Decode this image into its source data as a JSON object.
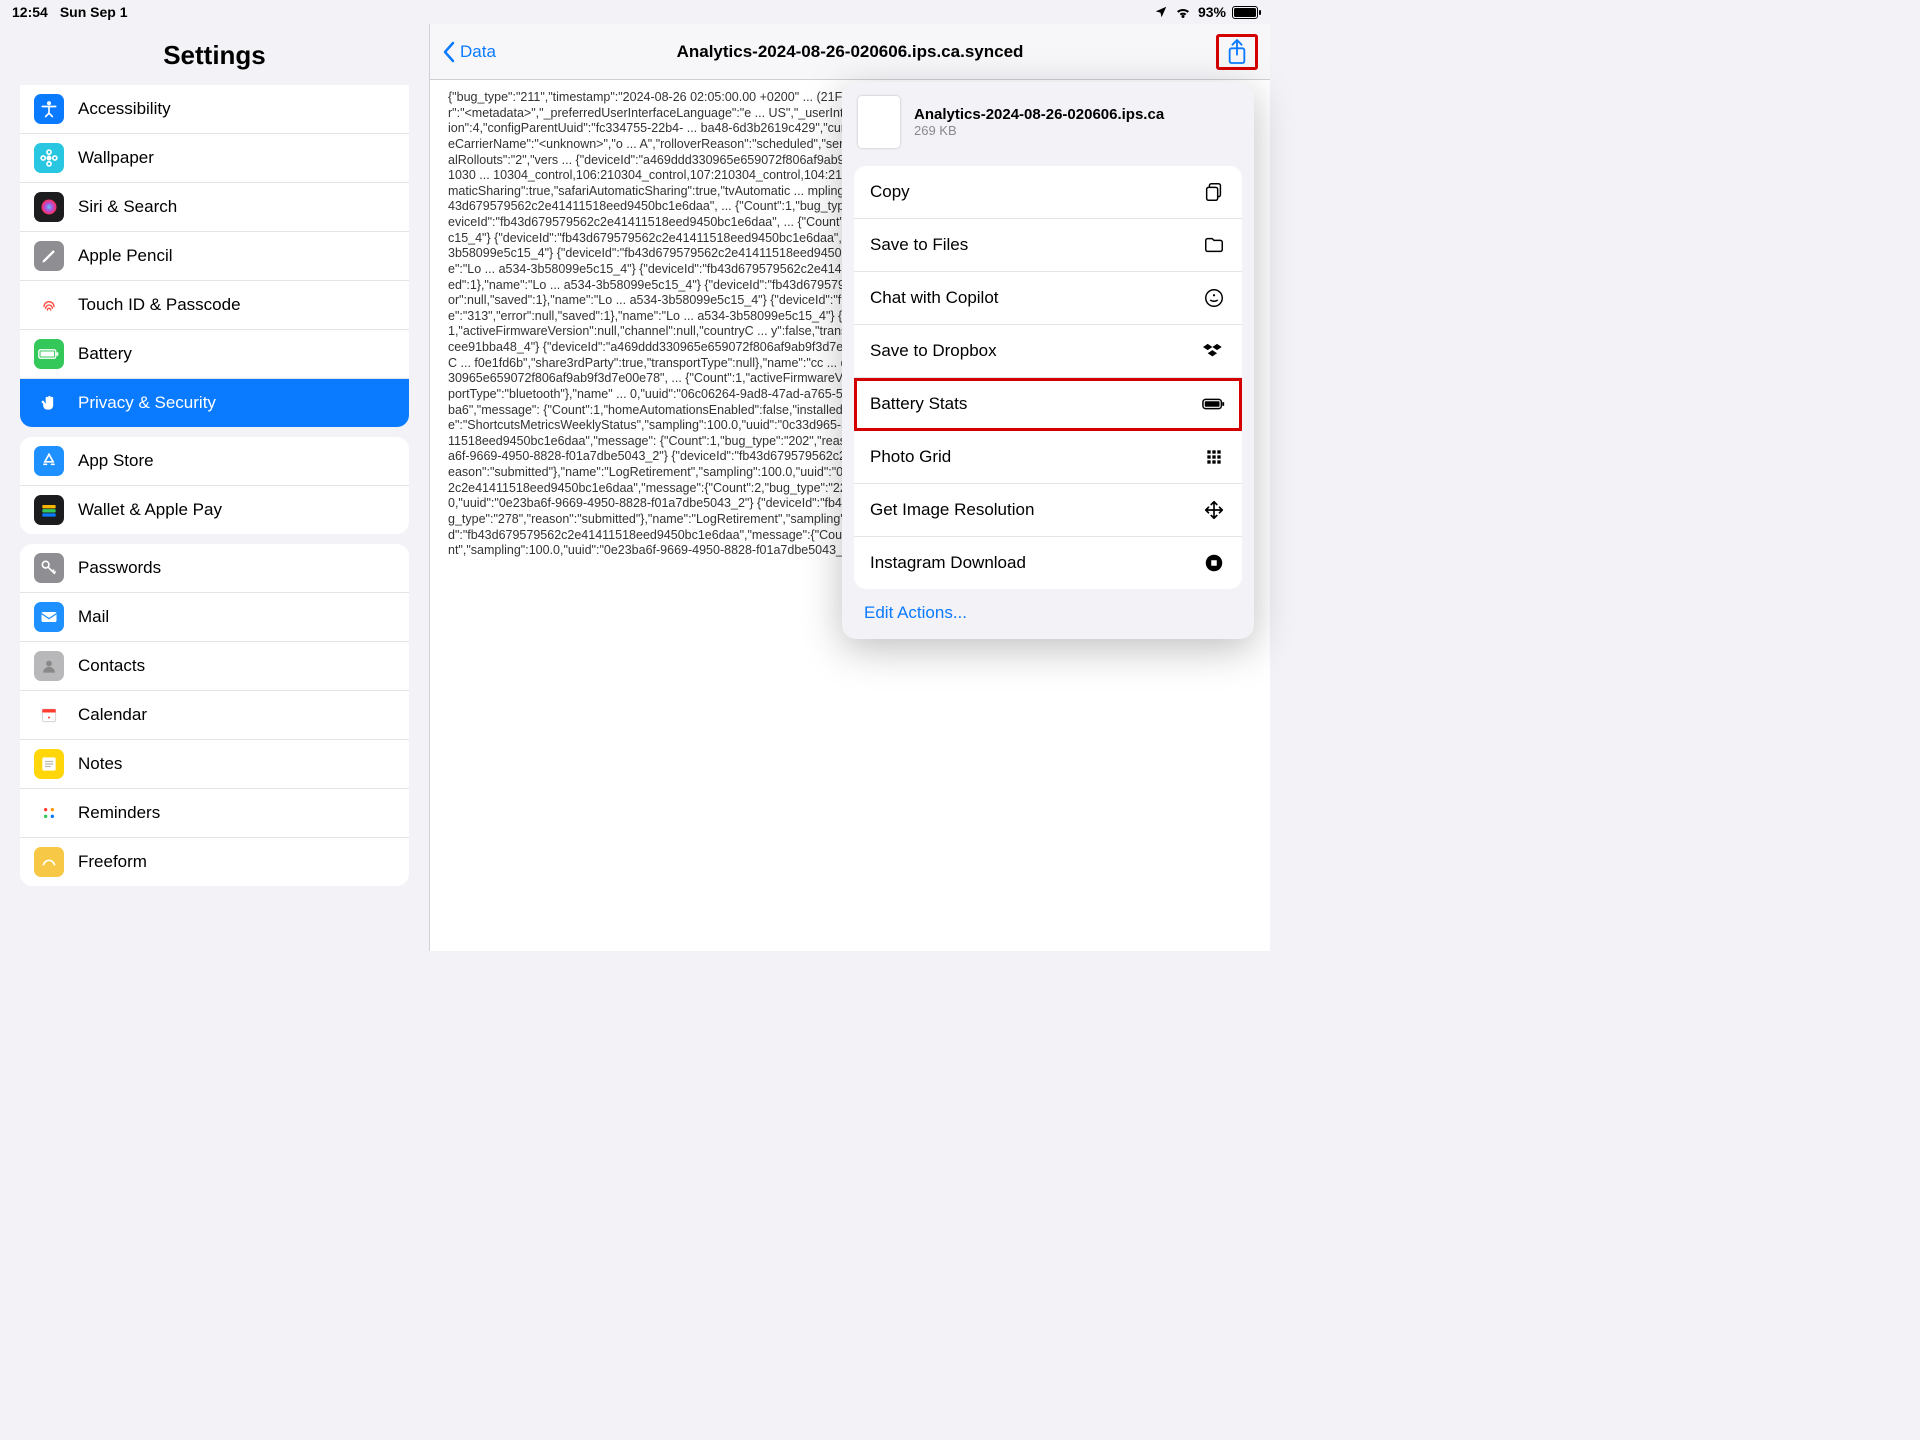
{
  "status": {
    "time": "12:54",
    "date": "Sun Sep 1",
    "location_icon": "location-icon",
    "wifi_icon": "wifi-icon",
    "battery_pct": "93%"
  },
  "sidebar": {
    "title": "Settings",
    "group1": [
      {
        "label": "Accessibility",
        "icon_bg": "#0a7aff",
        "data_name": "sidebar-item-accessibility",
        "icon": "accessibility-icon"
      },
      {
        "label": "Wallpaper",
        "icon_bg": "#28c6e0",
        "data_name": "sidebar-item-wallpaper",
        "icon": "flower-icon"
      },
      {
        "label": "Siri & Search",
        "icon_bg": "#1c1c1e",
        "data_name": "sidebar-item-siri",
        "icon": "siri-icon"
      },
      {
        "label": "Apple Pencil",
        "icon_bg": "#8e8e93",
        "data_name": "sidebar-item-pencil",
        "icon": "pencil-icon"
      },
      {
        "label": "Touch ID & Passcode",
        "icon_bg": "#ffffff",
        "data_name": "sidebar-item-touchid",
        "icon": "touchid-icon",
        "icon_fg": "#ff4b41"
      },
      {
        "label": "Battery",
        "icon_bg": "#34c759",
        "data_name": "sidebar-item-battery",
        "icon": "battery-icon"
      },
      {
        "label": "Privacy & Security",
        "icon_bg": "#0a7aff",
        "data_name": "sidebar-item-privacy",
        "icon": "hand-icon",
        "selected": true
      }
    ],
    "group2": [
      {
        "label": "App Store",
        "icon_bg": "#1e90ff",
        "data_name": "sidebar-item-appstore",
        "icon": "appstore-icon"
      },
      {
        "label": "Wallet & Apple Pay",
        "icon_bg": "#1c1c1e",
        "data_name": "sidebar-item-wallet",
        "icon": "wallet-icon"
      }
    ],
    "group3": [
      {
        "label": "Passwords",
        "icon_bg": "#8e8e93",
        "data_name": "sidebar-item-passwords",
        "icon": "key-icon"
      },
      {
        "label": "Mail",
        "icon_bg": "#1e90ff",
        "data_name": "sidebar-item-mail",
        "icon": "mail-icon"
      },
      {
        "label": "Contacts",
        "icon_bg": "#b8b8bb",
        "data_name": "sidebar-item-contacts",
        "icon": "contacts-icon"
      },
      {
        "label": "Calendar",
        "icon_bg": "#ffffff",
        "data_name": "sidebar-item-calendar",
        "icon": "calendar-icon",
        "icon_fg": "#ff3b30"
      },
      {
        "label": "Notes",
        "icon_bg": "#ffd60a",
        "data_name": "sidebar-item-notes",
        "icon": "notes-icon"
      },
      {
        "label": "Reminders",
        "icon_bg": "#ffffff",
        "data_name": "sidebar-item-reminders",
        "icon": "reminders-icon",
        "icon_fg": "#555"
      },
      {
        "label": "Freeform",
        "icon_bg": "#f7c846",
        "data_name": "sidebar-item-freeform",
        "icon": "freeform-icon"
      }
    ]
  },
  "detail": {
    "back": "Data",
    "title": "Analytics-2024-08-26-020606.ips.ca.synced",
    "log": "{\"bug_type\":\"211\",\"timestamp\":\"2024-08-26 02:05:00.00 +0200\" ... (21F90)\",\"roots_installed\":0,\"incident_id\":\"673B0F61-D6A3-4C6 ... {\"_marker\":\"<metadata>\",\"_preferredUserInterfaceLanguage\":\"e ... US\",\"_userInterfaceLanguage\":\"en\",\"_userSetRegionFormat\":\"U ... wn>\",\"configDbVersion\":4,\"configParentUuid\":\"fc334755-22b4- ... ba48-6d3b2619c429\",\"currentCountry\":\"Croatia\",\"deviceCapac ... arrierCountry\":\"<unknown>\",\"homeCarrierName\":\"<unknown>\",\"o ... A\",\"rolloverReason\":\"scheduled\",\"servingCarrierName\":\"<unkno ... stateDbVersion\":3,\"trialExperiments\":\"2\",\"trialRollouts\":\"2\",\"vers ... {\"deviceId\":\"a469ddd330965e659072f806af9ab9f3d7e00e78\", ... {\"Count\":1,\"activeSMSUser\":1,\"activeTreatments\":\"100:21030 ... 10304_control,106:210304_control,107:210304_control,104:210 ... \":1,\"automaticSharingEnabled\":2,\"musicAutomaticSharing\":true, ... tomaticSharing\":true,\"safariAutomaticSharing\":true,\"tvAutomatic ... mpling\":100.0,\"uuid\":\"02d92ea8-f2aa-4de8-a215-8251d53c3a5 ... {\"deviceId\":\"fb43d679579562c2e41411518eed9450bc1e6daa\", ... {\"Count\":1,\"bug_type\":\"211\",\"error\":null,\"saved\":1},\"name\":\"Lo ... a534-3b58099e5c15_4\"} {\"deviceId\":\"fb43d679579562c2e41411518eed9450bc1e6daa\", ... {\"Count\":4,\"bug_type\":\"202\",\"error\":null,\"saved\":1},\"name\":\"Lo ... a534-3b58099e5c15_4\"} {\"deviceId\":\"fb43d679579562c2e41411518eed9450bc1e6daa\", ... {\"Count\":1,\"bug_type\":\"298\",\"error\":null,\"saved\":1},\"name\":\"Lo ... a534-3b58099e5c15_4\"} {\"deviceId\":\"fb43d679579562c2e41411518eed9450bc1e6daa\", ... {\"Count\":1,\"bug_type\":\"145\",\"error\":null,\"saved\":1},\"name\":\"Lo ... a534-3b58099e5c15_4\"} {\"deviceId\":\"fb43d679579562c2e41411518eed9450bc1e6daa\", ... {\"Count\":5,\"bug_type\":\"308\",\"error\":null,\"saved\":1},\"name\":\"Lo ... a534-3b58099e5c15_4\"} {\"deviceId\":\"fb43d679579562c2e41411518eed9450bc1e6daa\", ... {\"Count\":2,\"bug_type\":\"225\",\"error\":null,\"saved\":1},\"name\":\"Lo ... a534-3b58099e5c15_4\"} {\"deviceId\":\"fb43d679579562c2e41411518eed9450bc1e6daa\", ... {\"Count\":9,\"bug_type\":\"313\",\"error\":null,\"saved\":1},\"name\":\"Lo ... a534-3b58099e5c15_4\"} {\"deviceId\":\"a469ddd330965e659072f806af9ab9f3d7e00e78\", ... {\"Count\":1,\"activeFirmwareVersion\":null,\"channel\":null,\"countryC ... y\":false,\"transportType\":\"bluetooth\"},\"name\":\"com_apple_aud_u ... 9ad8-47ad-a765-5ecee91bba48_4\"} {\"deviceId\":\"a469ddd330965e659072f806af9ab9f3d7e00e78\", ... {\"Count\":1,\"activeFirmwareVersion\":null,\"channel\":null,\"countryC ... f0e1fd6b\",\"share3rdParty\":true,\"transportType\":null},\"name\":\"cc ... d\":\"06c06264-9ad8-47ad-a765-5ecee91bba48_4\"} {\"deviceId\":\"a469ddd330965e659072f806af9ab9f3d7e00e78\", ... {\"Count\":1,\"activeFirmwareVersion\":\"1 7.30\",\"channel\":null,\"coun ... c4ba6\",\"share3rdParty\":true,\"transportType\":\"bluetooth\"},\"name\" ... 0,\"uuid\":\"06c06264-9ad8-47ad-a765-5ecee91bba48_4\"} {\"deviceId\":\"fe6f111b2c15fea09b2f6f5295395426e913eba6\",\"message\": {\"Count\":1,\"homeAutomationsEnabled\":false,\"installed\":true,\"personalAutomationsEnabled\":false,\"sleepEnabled\":false},\"name\":\"ShortcutsMetricsWeeklyStatus\",\"sampling\":100.0,\"uuid\":\"0c33d965-3789-4885-a6ab-73a145d0d264_5\"} {\"deviceId\":\"fb43d679579562c2e41411518eed9450bc1e6daa\",\"message\": {\"Count\":1,\"bug_type\":\"202\",\"reason\":\"submitted\"},\"name\":\"LogRetirement\",\"sampling\":100.0,\"uuid\":\"0e23ba6f-9669-4950-8828-f01a7dbe5043_2\"} {\"deviceId\":\"fb43d679579562c2e41411518eed9450bc1e6daa\",\"message\": {\"Count\":1,\"bug_type\":\"211\",\"reason\":\"submitted\"},\"name\":\"LogRetirement\",\"sampling\":100.0,\"uuid\":\"0e23ba6f-9669-4950-8828-f01a7dbe5043_2\"} {\"deviceId\":\"fb43d679579562c2e41411518eed9450bc1e6daa\",\"message\":{\"Count\":2,\"bug_type\":\"225\",\"reason\":\"rejected-config\"},\"name\":\"LogRetirement\",\"sampling\":100.0,\"uuid\":\"0e23ba6f-9669-4950-8828-f01a7dbe5043_2\"} {\"deviceId\":\"fb43d679579562c2e41411518eed9450bc1e6daa\",\"message\": {\"Count\":1,\"bug_type\":\"278\",\"reason\":\"submitted\"},\"name\":\"LogRetirement\",\"sampling\":100.0,\"uuid\":\"0e23ba6f-9669-4950-8828-f01a7dbe5043_2\"} {\"deviceId\":\"fb43d679579562c2e41411518eed9450bc1e6daa\",\"message\":{\"Count\":4,\"bug_type\":\"298\",\"reason\":\"rejected-blacklist\"},\"name\":\"LogRetirement\",\"sampling\":100.0,\"uuid\":\"0e23ba6f-9669-4950-8828-f01a7dbe5043_2\"}"
  },
  "share": {
    "file_name": "Analytics-2024-08-26-020606.ips.ca",
    "file_size": "269 KB",
    "actions": [
      {
        "label": "Copy",
        "data_name": "action-copy",
        "icon": "copy-icon"
      },
      {
        "label": "Save to Files",
        "data_name": "action-savefiles",
        "icon": "folder-icon"
      },
      {
        "label": "Chat with Copilot",
        "data_name": "action-copilot",
        "icon": "copilot-icon"
      },
      {
        "label": "Save to Dropbox",
        "data_name": "action-dropbox",
        "icon": "dropbox-icon"
      },
      {
        "label": "Battery Stats",
        "data_name": "action-batterystats",
        "icon": "battery-small-icon",
        "highlight": true
      },
      {
        "label": "Photo Grid",
        "data_name": "action-photogrid",
        "icon": "grid-icon"
      },
      {
        "label": "Get Image Resolution",
        "data_name": "action-imageres",
        "icon": "arrows-icon"
      },
      {
        "label": "Instagram Download",
        "data_name": "action-instagram",
        "icon": "circle-stop-icon"
      }
    ],
    "edit_label": "Edit Actions..."
  }
}
